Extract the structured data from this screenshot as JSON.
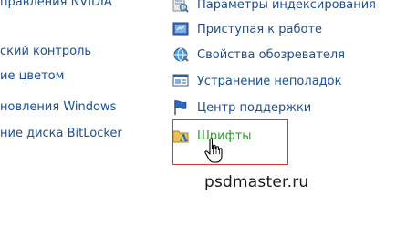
{
  "left_column": {
    "items": [
      "правления NVIDIA",
      "ский контроль",
      "ие цветом",
      "новления Windows",
      "ние диска BitLocker"
    ]
  },
  "right_column": {
    "items": [
      {
        "label": "Параметры индексирования",
        "icon": "indexing-options-icon"
      },
      {
        "label": "Приступая к работе",
        "icon": "getting-started-icon"
      },
      {
        "label": "Свойства обозревателя",
        "icon": "internet-options-icon"
      },
      {
        "label": "Устранение неполадок",
        "icon": "troubleshooting-icon"
      },
      {
        "label": "Центр поддержки",
        "icon": "action-center-flag-icon"
      },
      {
        "label": "Шрифты",
        "icon": "fonts-folder-icon",
        "selected": true
      }
    ]
  },
  "colors": {
    "link": "#1e4f8f",
    "selected_link": "#2a9a2a",
    "highlight_border": "#d53a3a",
    "background": "#ffffff"
  },
  "watermark": "psdmaster.ru"
}
